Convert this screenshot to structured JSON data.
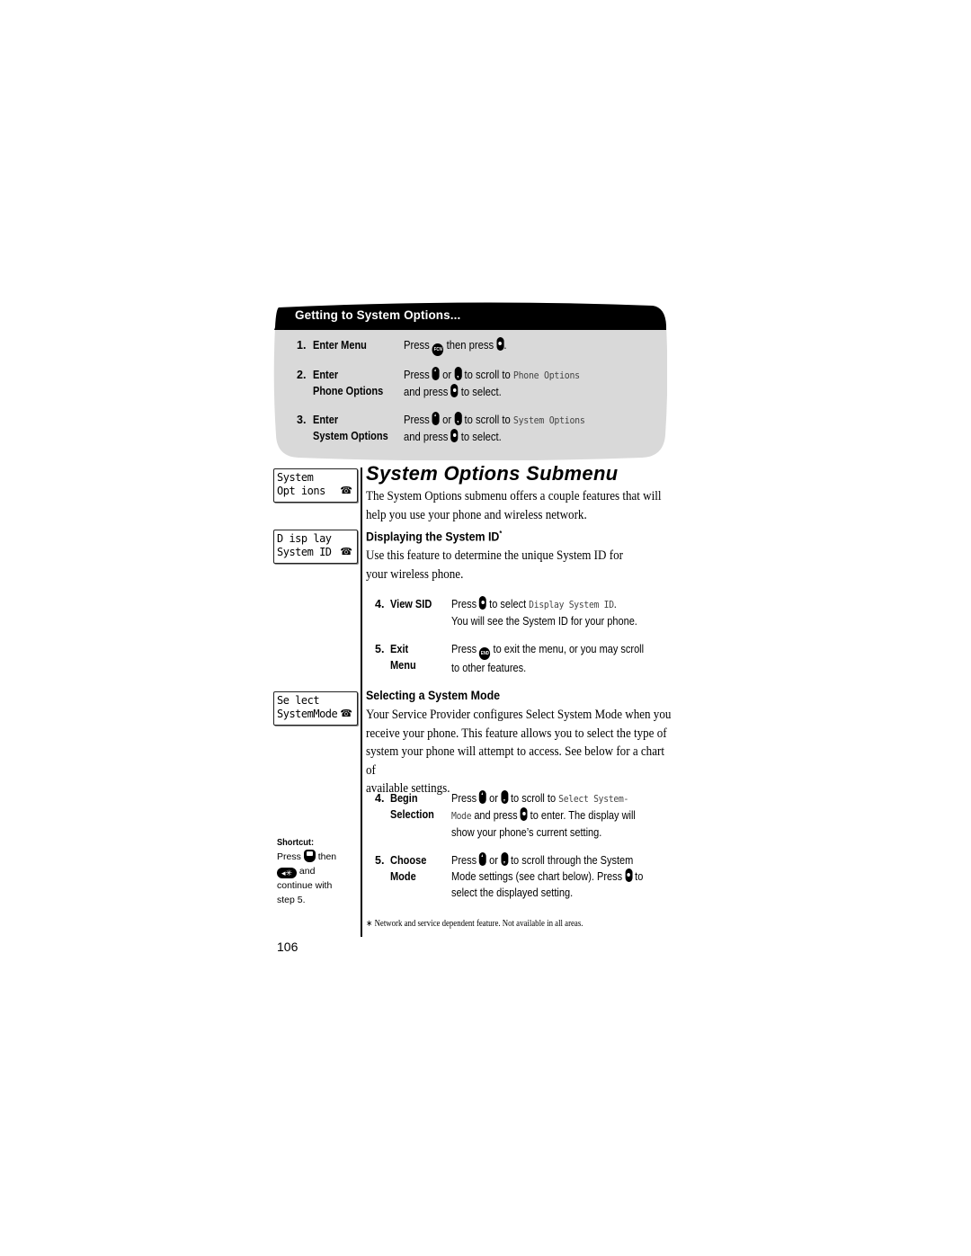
{
  "getting_box": {
    "title": "Getting to System Options...",
    "steps": [
      {
        "num": "1.",
        "label": [
          "Enter Menu"
        ],
        "lines": [
          [
            {
              "t": "Press "
            },
            {
              "key": "fcn",
              "name": "FCN"
            },
            {
              "t": " then press "
            },
            {
              "key": "select"
            },
            {
              "t": "."
            }
          ]
        ]
      },
      {
        "num": "2.",
        "label": [
          "Enter",
          "Phone Options"
        ],
        "lines": [
          [
            {
              "t": "Press "
            },
            {
              "key": "up"
            },
            {
              "t": " or "
            },
            {
              "key": "down"
            },
            {
              "t": " to scroll to "
            },
            {
              "lcd": "Phone Options"
            }
          ],
          [
            {
              "t": "and press "
            },
            {
              "key": "select"
            },
            {
              "t": " to select."
            }
          ]
        ]
      },
      {
        "num": "3.",
        "label": [
          "Enter",
          "System Options"
        ],
        "lines": [
          [
            {
              "t": "Press "
            },
            {
              "key": "up"
            },
            {
              "t": " or "
            },
            {
              "key": "down"
            },
            {
              "t": " to scroll to "
            },
            {
              "lcd": "System Options"
            }
          ],
          [
            {
              "t": "and press "
            },
            {
              "key": "select"
            },
            {
              "t": " to select."
            }
          ]
        ]
      }
    ]
  },
  "lcd_screens": [
    {
      "line1": "System",
      "line2": "Opt ions",
      "icon": "phone-icon"
    },
    {
      "line1": "D isp lay",
      "line2": "System ID",
      "icon": "phone-icon"
    },
    {
      "line1": "Se lect",
      "line2": "SystemMode",
      "icon": "phone-icon"
    }
  ],
  "main": {
    "title": "System Options Submenu",
    "intro": [
      "The System Options submenu offers a couple features that will",
      "help you use your phone and wireless network."
    ],
    "section1": {
      "heading": "Displaying the System ID",
      "heading_mark": "*",
      "body": [
        "Use this feature to determine the unique System ID for",
        "your wireless phone."
      ],
      "steps": [
        {
          "num": "4.",
          "label": [
            "View SID"
          ],
          "lines": [
            [
              {
                "t": "Press "
              },
              {
                "key": "select"
              },
              {
                "t": " to select "
              },
              {
                "lcd": "Display System ID"
              },
              {
                "t": "."
              }
            ],
            [
              {
                "t": "You will see the System ID for your phone."
              }
            ]
          ]
        },
        {
          "num": "5.",
          "label": [
            "Exit",
            "Menu"
          ],
          "lines": [
            [
              {
                "t": "Press "
              },
              {
                "key": "end",
                "name": "END"
              },
              {
                "t": " to exit the menu, or you may scroll"
              }
            ],
            [
              {
                "t": "to other features."
              }
            ]
          ]
        }
      ]
    },
    "section2": {
      "heading": "Selecting a System Mode",
      "body": [
        "Your Service Provider configures Select System Mode when you",
        "receive your phone. This feature allows you to select the type of",
        "system your phone will attempt to access. See below for a chart of",
        "available settings."
      ],
      "steps": [
        {
          "num": "4.",
          "label": [
            "Begin",
            "Selection"
          ],
          "lines": [
            [
              {
                "t": "Press "
              },
              {
                "key": "up"
              },
              {
                "t": " or "
              },
              {
                "key": "down"
              },
              {
                "t": " to scroll to "
              },
              {
                "lcd": "Select System-"
              }
            ],
            [
              {
                "lcd": "Mode"
              },
              {
                "t": " and press "
              },
              {
                "key": "select"
              },
              {
                "t": " to enter. The display will"
              }
            ],
            [
              {
                "t": "show your phone’s current setting."
              }
            ]
          ]
        },
        {
          "num": "5.",
          "label": [
            "Choose",
            "Mode"
          ],
          "lines": [
            [
              {
                "t": "Press "
              },
              {
                "key": "up"
              },
              {
                "t": " or "
              },
              {
                "key": "down"
              },
              {
                "t": " to scroll through the System"
              }
            ],
            [
              {
                "t": "Mode settings (see chart below). Press "
              },
              {
                "key": "select"
              },
              {
                "t": " to"
              }
            ],
            [
              {
                "t": "select the displayed setting."
              }
            ]
          ]
        }
      ]
    }
  },
  "shortcut": {
    "heading": "Shortcut:",
    "press": "Press",
    "then": "then",
    "and": "and",
    "star_key": "◂✳",
    "rest": [
      "continue with",
      "step 5."
    ]
  },
  "footnote": "∗ Network and service dependent feature. Not available in all areas.",
  "page_number": "106",
  "colors": {
    "box_gray": "#d9d9d9",
    "box_header": "#000000",
    "lcd_text": "#444444"
  }
}
